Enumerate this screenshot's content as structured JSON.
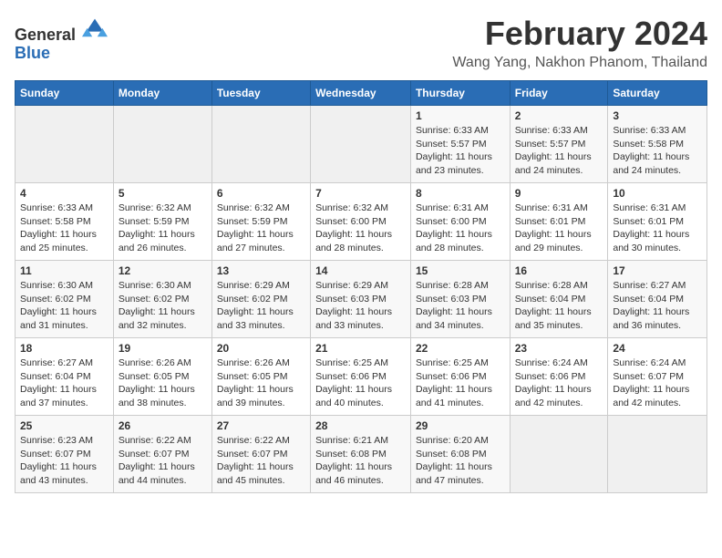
{
  "logo": {
    "general": "General",
    "blue": "Blue"
  },
  "header": {
    "title": "February 2024",
    "subtitle": "Wang Yang, Nakhon Phanom, Thailand"
  },
  "weekdays": [
    "Sunday",
    "Monday",
    "Tuesday",
    "Wednesday",
    "Thursday",
    "Friday",
    "Saturday"
  ],
  "weeks": [
    [
      {
        "day": "",
        "info": ""
      },
      {
        "day": "",
        "info": ""
      },
      {
        "day": "",
        "info": ""
      },
      {
        "day": "",
        "info": ""
      },
      {
        "day": "1",
        "info": "Sunrise: 6:33 AM\nSunset: 5:57 PM\nDaylight: 11 hours\nand 23 minutes."
      },
      {
        "day": "2",
        "info": "Sunrise: 6:33 AM\nSunset: 5:57 PM\nDaylight: 11 hours\nand 24 minutes."
      },
      {
        "day": "3",
        "info": "Sunrise: 6:33 AM\nSunset: 5:58 PM\nDaylight: 11 hours\nand 24 minutes."
      }
    ],
    [
      {
        "day": "4",
        "info": "Sunrise: 6:33 AM\nSunset: 5:58 PM\nDaylight: 11 hours\nand 25 minutes."
      },
      {
        "day": "5",
        "info": "Sunrise: 6:32 AM\nSunset: 5:59 PM\nDaylight: 11 hours\nand 26 minutes."
      },
      {
        "day": "6",
        "info": "Sunrise: 6:32 AM\nSunset: 5:59 PM\nDaylight: 11 hours\nand 27 minutes."
      },
      {
        "day": "7",
        "info": "Sunrise: 6:32 AM\nSunset: 6:00 PM\nDaylight: 11 hours\nand 28 minutes."
      },
      {
        "day": "8",
        "info": "Sunrise: 6:31 AM\nSunset: 6:00 PM\nDaylight: 11 hours\nand 28 minutes."
      },
      {
        "day": "9",
        "info": "Sunrise: 6:31 AM\nSunset: 6:01 PM\nDaylight: 11 hours\nand 29 minutes."
      },
      {
        "day": "10",
        "info": "Sunrise: 6:31 AM\nSunset: 6:01 PM\nDaylight: 11 hours\nand 30 minutes."
      }
    ],
    [
      {
        "day": "11",
        "info": "Sunrise: 6:30 AM\nSunset: 6:02 PM\nDaylight: 11 hours\nand 31 minutes."
      },
      {
        "day": "12",
        "info": "Sunrise: 6:30 AM\nSunset: 6:02 PM\nDaylight: 11 hours\nand 32 minutes."
      },
      {
        "day": "13",
        "info": "Sunrise: 6:29 AM\nSunset: 6:02 PM\nDaylight: 11 hours\nand 33 minutes."
      },
      {
        "day": "14",
        "info": "Sunrise: 6:29 AM\nSunset: 6:03 PM\nDaylight: 11 hours\nand 33 minutes."
      },
      {
        "day": "15",
        "info": "Sunrise: 6:28 AM\nSunset: 6:03 PM\nDaylight: 11 hours\nand 34 minutes."
      },
      {
        "day": "16",
        "info": "Sunrise: 6:28 AM\nSunset: 6:04 PM\nDaylight: 11 hours\nand 35 minutes."
      },
      {
        "day": "17",
        "info": "Sunrise: 6:27 AM\nSunset: 6:04 PM\nDaylight: 11 hours\nand 36 minutes."
      }
    ],
    [
      {
        "day": "18",
        "info": "Sunrise: 6:27 AM\nSunset: 6:04 PM\nDaylight: 11 hours\nand 37 minutes."
      },
      {
        "day": "19",
        "info": "Sunrise: 6:26 AM\nSunset: 6:05 PM\nDaylight: 11 hours\nand 38 minutes."
      },
      {
        "day": "20",
        "info": "Sunrise: 6:26 AM\nSunset: 6:05 PM\nDaylight: 11 hours\nand 39 minutes."
      },
      {
        "day": "21",
        "info": "Sunrise: 6:25 AM\nSunset: 6:06 PM\nDaylight: 11 hours\nand 40 minutes."
      },
      {
        "day": "22",
        "info": "Sunrise: 6:25 AM\nSunset: 6:06 PM\nDaylight: 11 hours\nand 41 minutes."
      },
      {
        "day": "23",
        "info": "Sunrise: 6:24 AM\nSunset: 6:06 PM\nDaylight: 11 hours\nand 42 minutes."
      },
      {
        "day": "24",
        "info": "Sunrise: 6:24 AM\nSunset: 6:07 PM\nDaylight: 11 hours\nand 42 minutes."
      }
    ],
    [
      {
        "day": "25",
        "info": "Sunrise: 6:23 AM\nSunset: 6:07 PM\nDaylight: 11 hours\nand 43 minutes."
      },
      {
        "day": "26",
        "info": "Sunrise: 6:22 AM\nSunset: 6:07 PM\nDaylight: 11 hours\nand 44 minutes."
      },
      {
        "day": "27",
        "info": "Sunrise: 6:22 AM\nSunset: 6:07 PM\nDaylight: 11 hours\nand 45 minutes."
      },
      {
        "day": "28",
        "info": "Sunrise: 6:21 AM\nSunset: 6:08 PM\nDaylight: 11 hours\nand 46 minutes."
      },
      {
        "day": "29",
        "info": "Sunrise: 6:20 AM\nSunset: 6:08 PM\nDaylight: 11 hours\nand 47 minutes."
      },
      {
        "day": "",
        "info": ""
      },
      {
        "day": "",
        "info": ""
      }
    ]
  ]
}
